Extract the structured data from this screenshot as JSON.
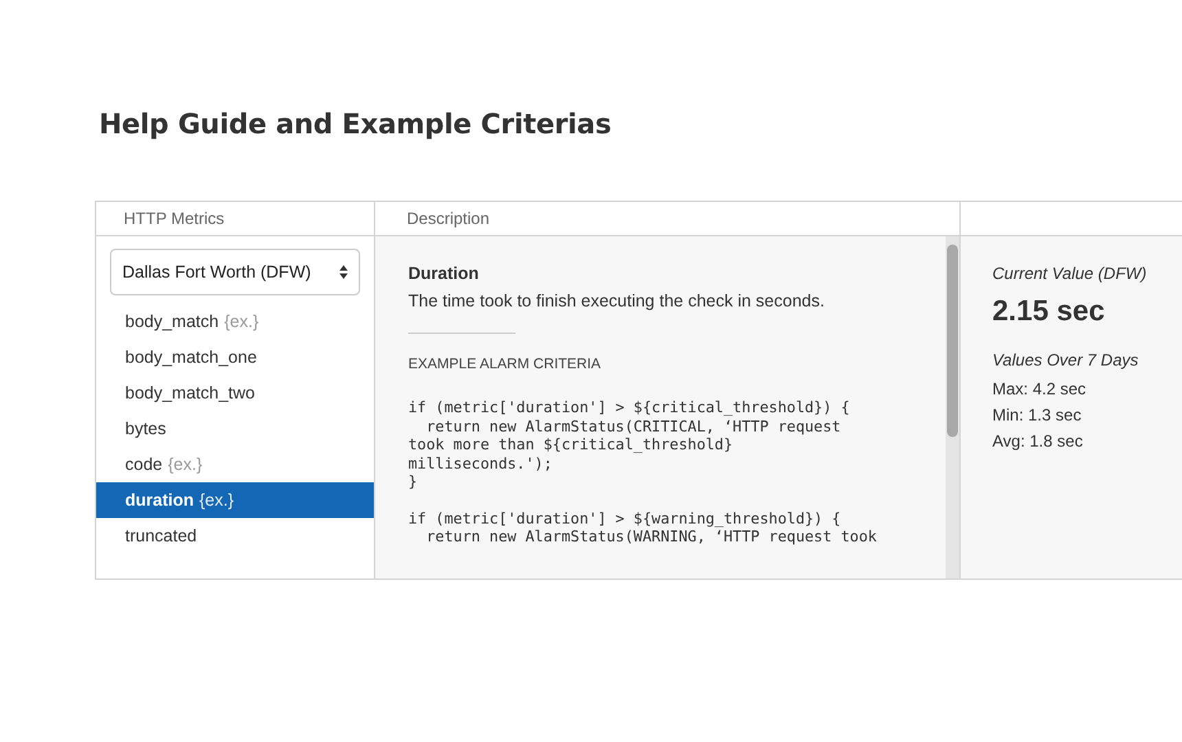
{
  "page_title": "Help Guide and Example Criterias",
  "columns": [
    "HTTP Metrics",
    "Description"
  ],
  "region_select": {
    "value": "Dallas Fort Worth (DFW)"
  },
  "metrics": [
    {
      "name": "body_match",
      "example": "{ex.}",
      "selected": false
    },
    {
      "name": "body_match_one",
      "selected": false
    },
    {
      "name": "body_match_two",
      "selected": false
    },
    {
      "name": "bytes",
      "selected": false
    },
    {
      "name": "code",
      "example": "{ex.}",
      "selected": false
    },
    {
      "name": "duration",
      "example": "{ex.}",
      "selected": true
    },
    {
      "name": "truncated",
      "selected": false
    }
  ],
  "description": {
    "title": "Duration",
    "text": "The time took to finish executing the check in seconds.",
    "criteria_heading": "EXAMPLE ALARM CRITERIA",
    "code_blocks": [
      [
        "if (metric['duration'] > ${critical_threshold}) {",
        "  return new AlarmStatus(CRITICAL, ‘HTTP request",
        "took more than ${critical_threshold}",
        "milliseconds.');",
        "}"
      ],
      [
        "if (metric['duration'] > ${warning_threshold}) {",
        "  return new AlarmStatus(WARNING, ‘HTTP request took"
      ]
    ]
  },
  "stats": {
    "current_label": "Current Value (DFW)",
    "current_value": "2.15 sec",
    "range_label": "Values Over 7 Days",
    "lines": [
      "Max: 4.2 sec",
      "Min: 1.3 sec",
      "Avg: 1.8 sec"
    ]
  }
}
